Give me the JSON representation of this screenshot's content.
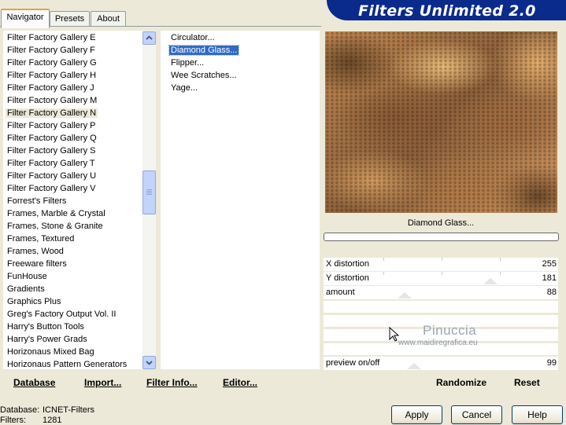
{
  "brand": {
    "title": "Filters Unlimited 2.0"
  },
  "tabs": [
    {
      "label": "Navigator",
      "active": true
    },
    {
      "label": "Presets",
      "active": false
    },
    {
      "label": "About",
      "active": false
    }
  ],
  "categories": [
    "Filter Factory Gallery E",
    "Filter Factory Gallery F",
    "Filter Factory Gallery G",
    "Filter Factory Gallery H",
    "Filter Factory Gallery J",
    "Filter Factory Gallery M",
    "Filter Factory Gallery N",
    "Filter Factory Gallery P",
    "Filter Factory Gallery Q",
    "Filter Factory Gallery S",
    "Filter Factory Gallery T",
    "Filter Factory Gallery U",
    "Filter Factory Gallery V",
    "Forrest's Filters",
    "Frames, Marble & Crystal",
    "Frames, Stone & Granite",
    "Frames, Textured",
    "Frames, Wood",
    "Freeware filters",
    "FunHouse",
    "Gradients",
    "Graphics Plus",
    "Greg's Factory Output Vol. II",
    "Harry's Button Tools",
    "Harry's Power Grads",
    "Horizonaus Mixed Bag",
    "Horizonaus Pattern Generators"
  ],
  "selected_category": "Filter Factory Gallery N",
  "filters": [
    "Circulator...",
    "Diamond Glass...",
    "Flipper...",
    "Wee Scratches...",
    "Yage..."
  ],
  "selected_filter": "Diamond Glass...",
  "preview": {
    "caption": "Diamond Glass..."
  },
  "params": [
    {
      "label": "X distortion",
      "value": "255"
    },
    {
      "label": "Y distortion",
      "value": "181"
    },
    {
      "label": "amount",
      "value": "88"
    },
    {
      "label": "preview on/off",
      "value": "99"
    }
  ],
  "watermark": {
    "name": "Pinuccia",
    "url": "www.maidiregrafica.eu"
  },
  "bottom_links": {
    "database": "Database",
    "import": "Import...",
    "filter_info": "Filter Info...",
    "editor": "Editor..."
  },
  "right_links": {
    "randomize": "Randomize",
    "reset": "Reset"
  },
  "status": {
    "database_label": "Database:",
    "database_value": "ICNET-Filters",
    "filters_label": "Filters:",
    "filters_value": "1281"
  },
  "buttons": {
    "apply": "Apply",
    "cancel": "Cancel",
    "help": "Help"
  },
  "colors": {
    "brand": "#0a2a8c",
    "selection": "#316ac5",
    "tab_accent": "#e6a23c"
  }
}
